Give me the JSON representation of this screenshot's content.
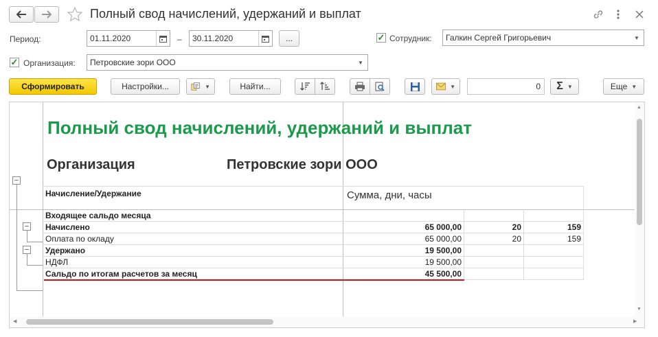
{
  "window": {
    "title": "Полный свод начислений, удержаний и выплат"
  },
  "filters": {
    "period_label": "Период:",
    "date_from": "01.11.2020",
    "date_sep": "–",
    "date_to": "30.11.2020",
    "period_more": "...",
    "employee_label": "Сотрудник:",
    "employee_value": "Галкин Сергей Григорьевич",
    "org_label": "Организация:",
    "org_value": "Петровские зори ООО"
  },
  "toolbar": {
    "generate": "Сформировать",
    "settings": "Настройки...",
    "find": "Найти...",
    "sum_value": "0",
    "sum_symbol": "Σ",
    "more": "Еще"
  },
  "report": {
    "title": "Полный свод начислений, удержаний и выплат",
    "org_caption": "Организация",
    "org_name": "Петровские зори ООО",
    "col_header_1": "Начисление/Удержание",
    "col_header_2": "Сумма, дни, часы",
    "rows": [
      {
        "name": "Входящее сальдо месяца",
        "sum": "",
        "days": "",
        "hours": ""
      },
      {
        "name": "Начислено",
        "sum": "65 000,00",
        "days": "20",
        "hours": "159"
      },
      {
        "name": "Оплата по окладу",
        "sum": "65 000,00",
        "days": "20",
        "hours": "159"
      },
      {
        "name": "Удержано",
        "sum": "19 500,00",
        "days": "",
        "hours": ""
      },
      {
        "name": "НДФЛ",
        "sum": "19 500,00",
        "days": "",
        "hours": ""
      },
      {
        "name": "Сальдо по итогам расчетов за месяц",
        "sum": "45 500,00",
        "days": "",
        "hours": ""
      }
    ]
  },
  "colors": {
    "title_green": "#1a9a4a",
    "generate_yellow": "#f5d21a",
    "underline_red": "#d0141c"
  }
}
